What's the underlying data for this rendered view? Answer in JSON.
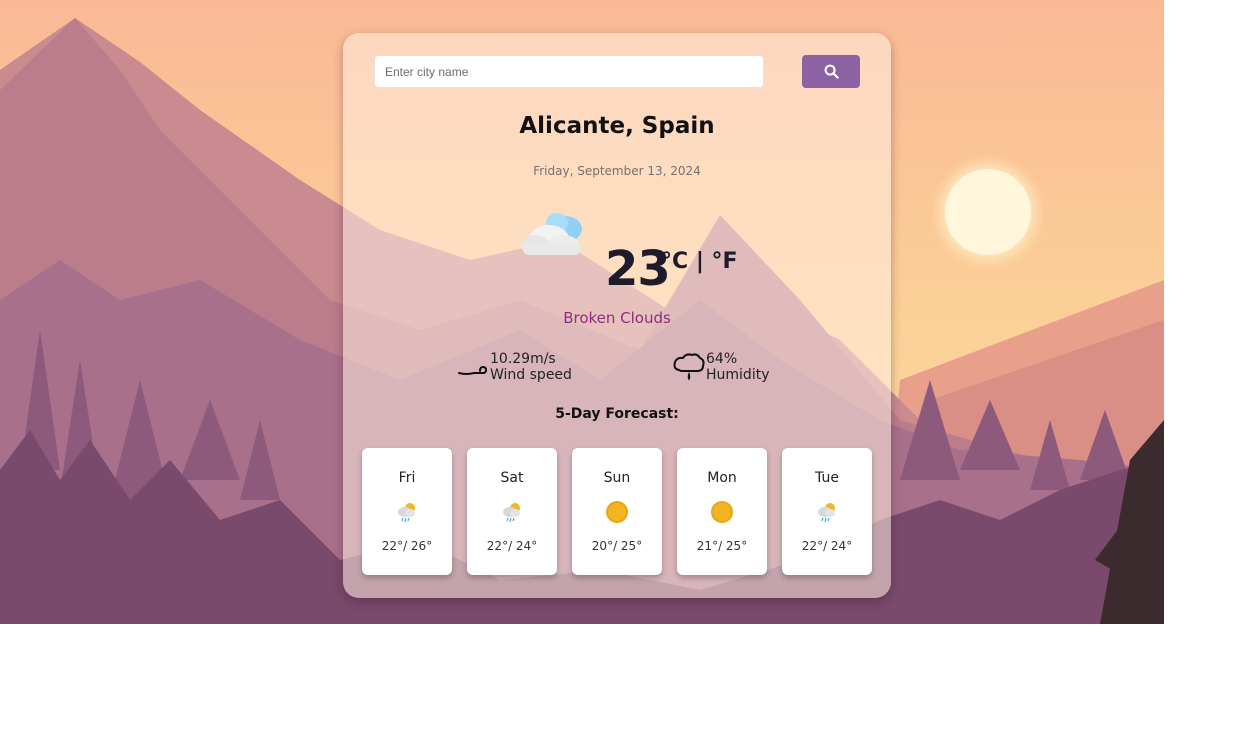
{
  "search": {
    "placeholder": "Enter city name",
    "value": ""
  },
  "search_button_icon": "search-icon",
  "location": {
    "city": "Alicante, Spain",
    "date": "Friday, September 13, 2024"
  },
  "current": {
    "icon": "broken-clouds-icon",
    "temperature": "23",
    "unit_celsius": "°C",
    "unit_separator": " | ",
    "unit_fahrenheit": "°F",
    "condition": "Broken Clouds"
  },
  "wind": {
    "icon": "wind-icon",
    "value": "10.29m/s",
    "label": "Wind speed"
  },
  "humidity": {
    "icon": "humidity-icon",
    "value": "64%",
    "label": "Humidity"
  },
  "forecast": {
    "title": "5-Day Forecast:",
    "days": [
      {
        "day": "Fri",
        "icon": "light-rain-icon",
        "temps": "22°/ 26°"
      },
      {
        "day": "Sat",
        "icon": "light-rain-icon",
        "temps": "22°/ 24°"
      },
      {
        "day": "Sun",
        "icon": "sun-icon",
        "temps": "20°/ 25°"
      },
      {
        "day": "Mon",
        "icon": "sun-icon",
        "temps": "21°/ 25°"
      },
      {
        "day": "Tue",
        "icon": "light-rain-icon",
        "temps": "22°/ 24°"
      }
    ]
  },
  "colors": {
    "accent_button": "#8d62a2",
    "condition_text": "#8b2f7c",
    "sky_top": "#f9b995",
    "sun": "#fff6dc"
  }
}
